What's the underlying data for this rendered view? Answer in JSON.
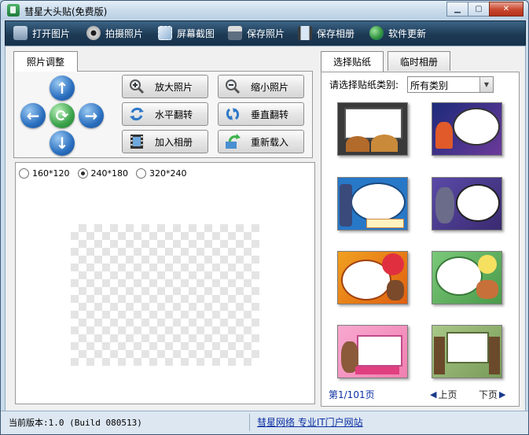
{
  "window": {
    "title": "彗星大头贴(免费版)",
    "min_icon": "minimize-icon",
    "max_icon": "maximize-icon",
    "close_icon": "close-icon"
  },
  "toolbar": {
    "items": [
      {
        "label": "打开图片",
        "icon": "folder-open-icon"
      },
      {
        "label": "拍摄照片",
        "icon": "webcam-icon"
      },
      {
        "label": "屏幕截图",
        "icon": "screenshot-icon"
      },
      {
        "label": "保存照片",
        "icon": "floppy-disk-icon"
      },
      {
        "label": "保存相册",
        "icon": "album-save-icon"
      },
      {
        "label": "软件更新",
        "icon": "update-globe-icon"
      }
    ]
  },
  "adjust": {
    "tab_label": "照片调整",
    "buttons": [
      {
        "label": "放大照片",
        "icon": "zoom-in-icon"
      },
      {
        "label": "缩小照片",
        "icon": "zoom-out-icon"
      },
      {
        "label": "水平翻转",
        "icon": "flip-horizontal-icon"
      },
      {
        "label": "垂直翻转",
        "icon": "flip-vertical-icon"
      },
      {
        "label": "加入相册",
        "icon": "film-strip-icon"
      },
      {
        "label": "重新载入",
        "icon": "reload-icon"
      }
    ]
  },
  "sizes": {
    "options": [
      "160*120",
      "240*180",
      "320*240"
    ],
    "selected": "240*180"
  },
  "sticker_tabs": {
    "tab1": "选择贴纸",
    "tab2": "临时相册"
  },
  "sticker_filter": {
    "label": "请选择贴纸类别:",
    "value": "所有类别"
  },
  "pager": {
    "page_info": "第1/101页",
    "prev": "上页",
    "next": "下页"
  },
  "status": {
    "version": "当前版本:1.0 (Build 080513)",
    "link": "彗星网络 专业IT门户网站"
  },
  "colors": {
    "toolbar": "#1d3a55",
    "arrow_blue": "#2a6fbf",
    "arrow_green": "#3aa24a",
    "link": "#0b2fa3"
  }
}
